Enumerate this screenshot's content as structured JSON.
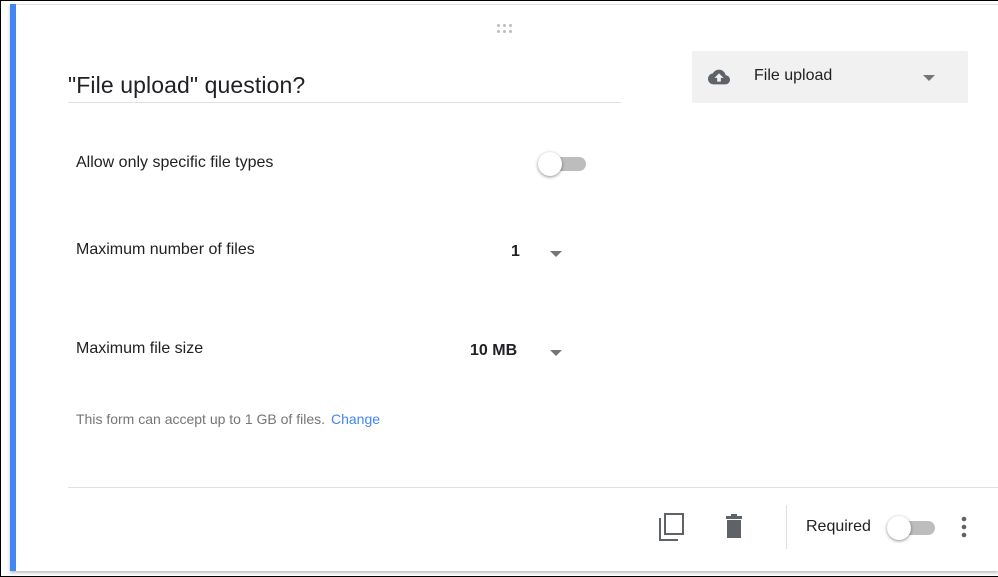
{
  "question": {
    "title": "\"File upload\" question?",
    "type_select": {
      "label": "File upload",
      "icon": "cloud-upload-icon"
    }
  },
  "settings": {
    "specific_types": {
      "label": "Allow only specific file types",
      "enabled": false
    },
    "max_files": {
      "label": "Maximum number of files",
      "value": "1"
    },
    "max_size": {
      "label": "Maximum file size",
      "value": "10 MB"
    },
    "note": {
      "text": "This form can accept up to 1 GB of files.",
      "link": "Change"
    }
  },
  "footer": {
    "duplicate_icon": "copy-icon",
    "delete_icon": "trash-icon",
    "required_label": "Required",
    "required_enabled": false,
    "more_icon": "more-vertical-icon"
  },
  "colors": {
    "accent": "#4285f4",
    "toggle_track_off": "#bdbdbd",
    "link": "#4285f4"
  }
}
